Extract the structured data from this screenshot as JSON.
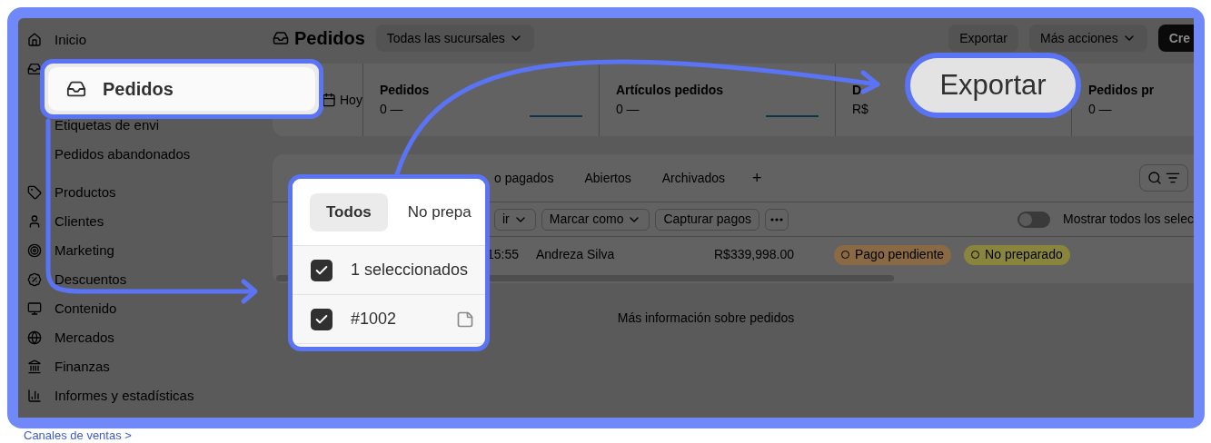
{
  "sidebar": {
    "items": [
      {
        "label": "Inicio",
        "kind": "home"
      },
      {
        "kind": "inbox",
        "children": [
          {
            "label": "Etiquetas de envi"
          },
          {
            "label": "Pedidos abandonados"
          }
        ]
      },
      {
        "label": "Productos",
        "kind": "tag"
      },
      {
        "label": "Clientes",
        "kind": "user"
      },
      {
        "label": "Marketing",
        "kind": "target"
      },
      {
        "label": "Descuentos",
        "kind": "badge"
      },
      {
        "label": "Contenido",
        "kind": "monitor"
      },
      {
        "label": "Mercados",
        "kind": "globe"
      },
      {
        "label": "Finanzas",
        "kind": "bank"
      },
      {
        "label": "Informes y estadísticas",
        "kind": "chart"
      }
    ],
    "footer_link": "Canales de ventas >"
  },
  "header": {
    "title": "Pedidos",
    "location": "Todas las sucursales",
    "buttons": [
      {
        "label": "Exportar",
        "dropdown": false
      },
      {
        "label": "Más acciones",
        "dropdown": true
      }
    ],
    "primary_button": "Cre"
  },
  "stats": [
    {
      "kind": "date",
      "label": "Hoy"
    },
    {
      "kind": "metric",
      "label": "Pedidos",
      "value": "0 —"
    },
    {
      "kind": "metric",
      "label": "Artículos pedidos",
      "value": "0 —"
    },
    {
      "kind": "metric",
      "label": "D",
      "value": "R$"
    },
    {
      "kind": "metric",
      "label": "Pedidos pr",
      "value": "0 —"
    }
  ],
  "tabs": [
    {
      "label": "o pagados",
      "selected": false
    },
    {
      "label": "Abiertos",
      "selected": false
    },
    {
      "label": "Archivados",
      "selected": false
    }
  ],
  "add_tab": "+",
  "bulk_actions": [
    {
      "label": "ir",
      "dropdown": true
    },
    {
      "label": "Marcar como",
      "dropdown": true
    },
    {
      "label": "Capturar pagos",
      "dropdown": false
    }
  ],
  "toggle": {
    "label": "Mostrar todos los selec",
    "on": false
  },
  "order_row": {
    "time": "15:55",
    "customer": "Andreza Silva",
    "total": "R$339,998.00",
    "badges": [
      {
        "label": "Pago pendiente",
        "color": "#8a6a44"
      },
      {
        "label": "No preparado",
        "color": "#8a853c"
      }
    ]
  },
  "learn_more": "Más información sobre pedidos",
  "callouts": [
    {
      "kind": "nav",
      "label": "Pedidos"
    },
    {
      "kind": "button",
      "label": "Exportar"
    },
    {
      "kind": "table",
      "tabs": [
        {
          "label": "Todos",
          "selected": true
        },
        {
          "label": "No prepa",
          "selected": false
        }
      ],
      "rows": [
        {
          "label": "1 seleccionados",
          "checked": true,
          "note": false
        },
        {
          "label": "#1002",
          "checked": true,
          "note": true
        }
      ]
    }
  ]
}
